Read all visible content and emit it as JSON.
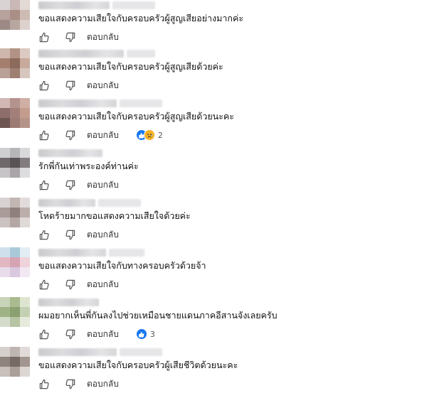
{
  "reply_label": "ตอบกลับ",
  "colors": {
    "like_blue": "#1877f2",
    "sad_yellow": "#f7b125",
    "icon_gray": "#555555"
  },
  "comments": [
    {
      "text": "ขอแสดงความเสียใจกับครอบครัวผู้สูญเสียอย่างมากค่ะ",
      "reactions": null,
      "avatar": [
        "#d9d3d3",
        "#c9b8b5",
        "#e3d9d5",
        "#b7a29e",
        "#a98f86",
        "#cdbbb4",
        "#9d8a86",
        "#b8a7a0",
        "#dcd1cd"
      ]
    },
    {
      "text": "ขอแสดงความเสียใจกับครอบครัวผู้สูญเสียด้วยค่ะ",
      "reactions": null,
      "avatar": [
        "#cdb7ad",
        "#b19284",
        "#dcc9c1",
        "#a57f6e",
        "#8c6a5c",
        "#c7aa9c",
        "#b9a197",
        "#9e7f71",
        "#d6c6be"
      ]
    },
    {
      "text": "ขอแสดงความเสียใจกับครอบครัวผู้สูญเสียด้วยนะคะ",
      "reactions": {
        "count": "2",
        "icons": [
          "like-reaction-icon",
          "sad-reaction-icon"
        ]
      },
      "avatar": [
        "#d2b8b5",
        "#b4928d",
        "#cfaea4",
        "#8e6e6a",
        "#a27f79",
        "#c49c8e",
        "#6d5552",
        "#9b7b73",
        "#b59388"
      ]
    },
    {
      "text": "รักพี่กันเท่าพระองค์ท่านค่ะ",
      "reactions": null,
      "avatar": [
        "#cfcfd1",
        "#b7b5b8",
        "#d9d8da",
        "#6f686b",
        "#5a5356",
        "#837c7f",
        "#c6c4c6",
        "#a9a5a8",
        "#dddcde"
      ]
    },
    {
      "text": "โหดร้ายมากขอแสดงความเสียใจด้วยค่ะ",
      "reactions": null,
      "avatar": [
        "#d8d2d2",
        "#c2b6b3",
        "#e1dcdb",
        "#a99b98",
        "#8f807d",
        "#bcaeab",
        "#cbc3c1",
        "#b4a7a4",
        "#dfd9d8"
      ]
    },
    {
      "text": "ขอแสดงความเสียใจกับทางครอบครัวด้วยจ้า",
      "reactions": null,
      "avatar": [
        "#cfe0ec",
        "#a9c9d9",
        "#e2edf3",
        "#e3b7c2",
        "#d6a3b2",
        "#efd3da",
        "#e8dcea",
        "#d9c8de",
        "#f1e8f2"
      ]
    },
    {
      "text": "ผมอยากเห็นพี่กันลงไปช่วยเหมือนชายแดนภาคอีสานจังเลยครับ",
      "reactions": {
        "count": "3",
        "icons": [
          "like-reaction-icon"
        ]
      },
      "avatar": [
        "#c8d4b7",
        "#a9bb8f",
        "#dde5d0",
        "#9fb387",
        "#8aa070",
        "#c3d0b1",
        "#d5dccb",
        "#b7c4a4",
        "#e5eadc"
      ]
    },
    {
      "text": "ขอแสดงความเสียใจกับครอบครัวผู้เสียชีวิตด้วยนะคะ",
      "reactions": null,
      "avatar": [
        "#d6d0cd",
        "#bfb5b0",
        "#e0dbd8",
        "#8f837d",
        "#766a64",
        "#a39690",
        "#c9c0bb",
        "#ab9f99",
        "#ddd7d3"
      ]
    }
  ]
}
